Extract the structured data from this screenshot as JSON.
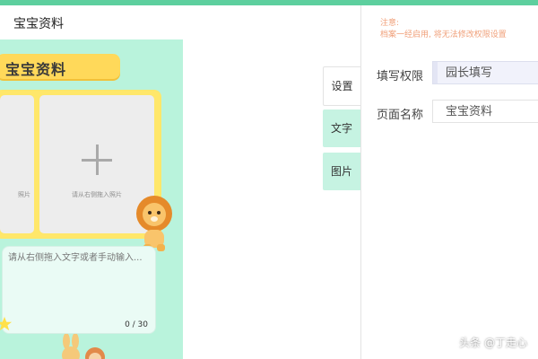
{
  "header": {
    "title": "宝宝资料"
  },
  "preview": {
    "banner_title": "宝宝资料",
    "photo_hint_left": "照片",
    "photo_hint_right": "请从右侧拖入照片",
    "text_placeholder": "请从右侧拖入文字或者手动输入...",
    "text_counter": "0 / 30"
  },
  "tabs": [
    {
      "label": "设置",
      "active": true
    },
    {
      "label": "文字",
      "active": false
    },
    {
      "label": "图片",
      "active": false
    }
  ],
  "settings": {
    "notice_line1": "注意:",
    "notice_line2": "档案一经启用, 将无法修改权限设置",
    "permission_label": "填写权限",
    "permission_value": "园长填写",
    "page_name_label": "页面名称",
    "page_name_value": "宝宝资料"
  },
  "watermark": "头条 @丁走心",
  "colors": {
    "accent": "#5dcf9e",
    "preview_bg": "#b9f3dc",
    "banner": "#ffd95a",
    "notice": "#f0a07a"
  }
}
